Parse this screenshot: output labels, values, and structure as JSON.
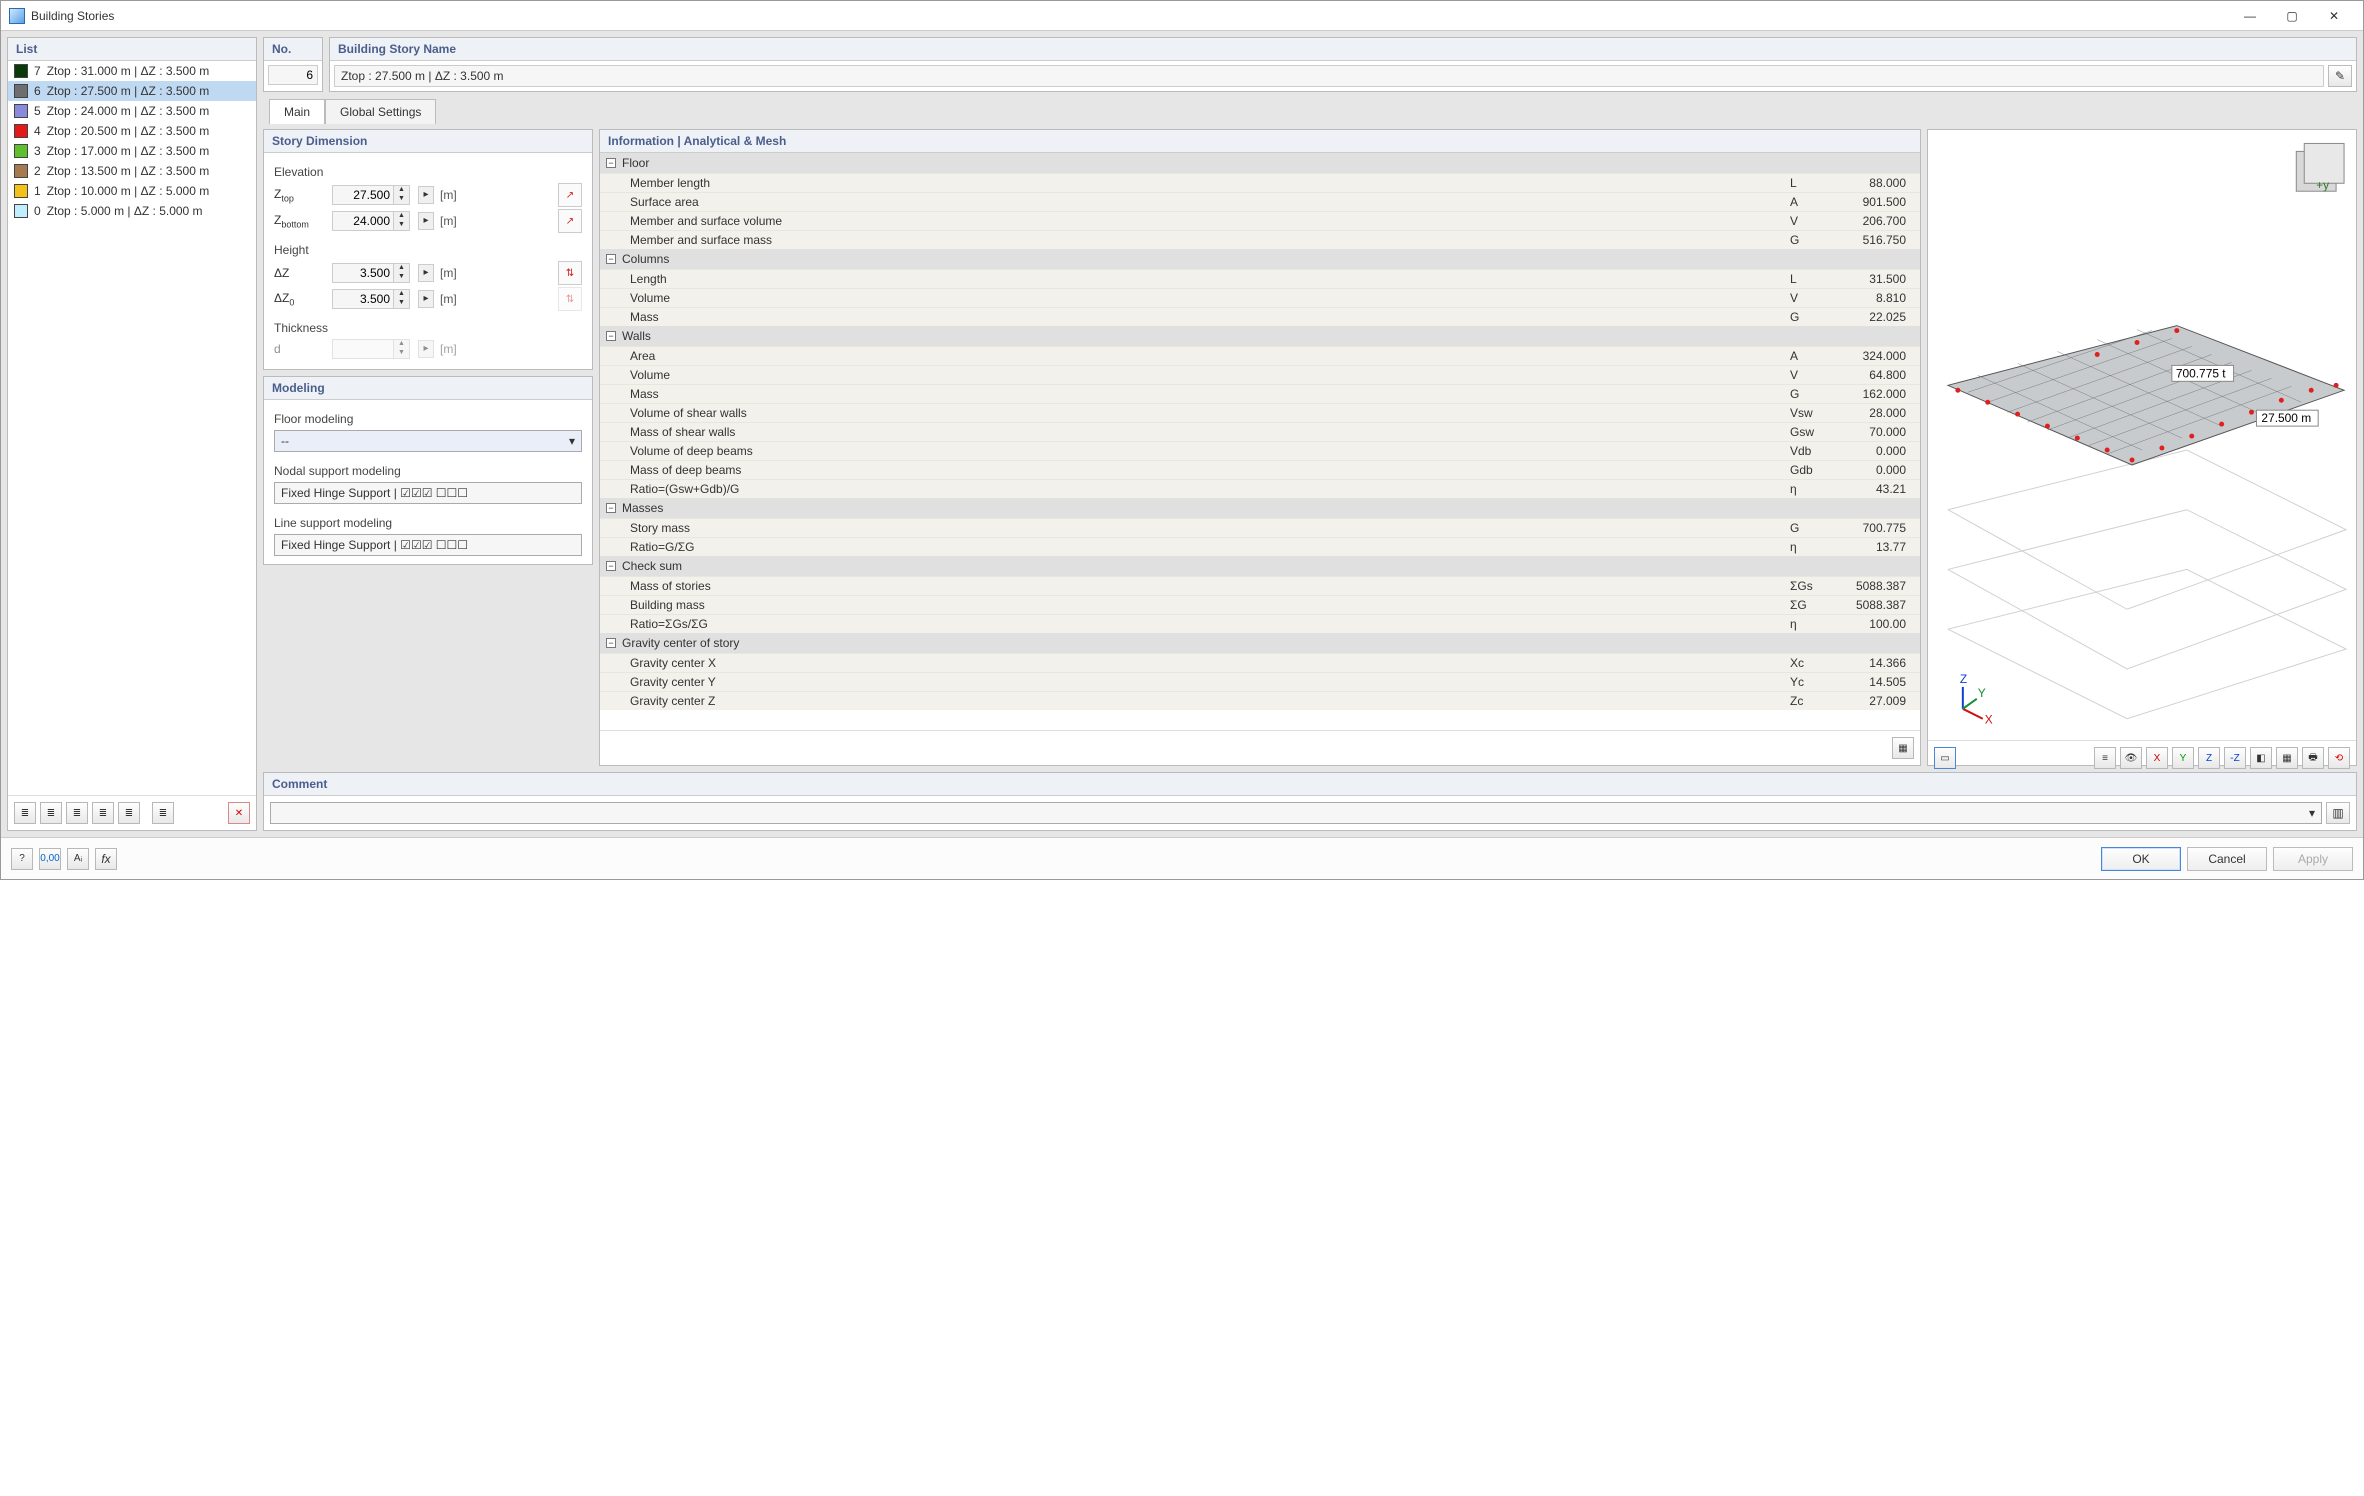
{
  "window_title": "Building Stories",
  "list_header": "List",
  "stories": [
    {
      "num": "7",
      "label": "Ztop : 31.000 m | ΔZ : 3.500 m",
      "color": "#0a3a0a"
    },
    {
      "num": "6",
      "label": "Ztop : 27.500 m | ΔZ : 3.500 m",
      "color": "#6e6e6e",
      "selected": true
    },
    {
      "num": "5",
      "label": "Ztop : 24.000 m | ΔZ : 3.500 m",
      "color": "#8a8adc"
    },
    {
      "num": "4",
      "label": "Ztop : 20.500 m | ΔZ : 3.500 m",
      "color": "#e21a1a"
    },
    {
      "num": "3",
      "label": "Ztop : 17.000 m | ΔZ : 3.500 m",
      "color": "#5fbf2e"
    },
    {
      "num": "2",
      "label": "Ztop : 13.500 m | ΔZ : 3.500 m",
      "color": "#a57a4f"
    },
    {
      "num": "1",
      "label": "Ztop : 10.000 m | ΔZ : 5.000 m",
      "color": "#f2c21a"
    },
    {
      "num": "0",
      "label": "Ztop : 5.000 m | ΔZ : 5.000 m",
      "color": "#bfefff"
    }
  ],
  "no_header": "No.",
  "no_value": "6",
  "name_header": "Building Story Name",
  "name_value": "Ztop : 27.500 m | ΔZ : 3.500 m",
  "tabs": {
    "main": "Main",
    "global": "Global Settings"
  },
  "dim_header": "Story Dimension",
  "labels": {
    "elevation": "Elevation",
    "ztop": "Ztop",
    "zbot": "Zbottom",
    "height": "Height",
    "dz": "ΔZ",
    "dz0": "ΔZ0",
    "thickness": "Thickness",
    "d": "d",
    "m": "[m]"
  },
  "vals": {
    "ztop": "27.500",
    "zbot": "24.000",
    "dz": "3.500",
    "dz0": "3.500",
    "d": ""
  },
  "mod_header": "Modeling",
  "mod": {
    "floor": "Floor modeling",
    "floor_val": "--",
    "nodal": "Nodal support modeling",
    "nodal_val": "Fixed Hinge Support | ☑☑☑ ☐☐☐",
    "line": "Line support modeling",
    "line_val": "Fixed Hinge Support | ☑☑☑ ☐☐☐"
  },
  "info_header": "Information | Analytical & Mesh",
  "groups": [
    {
      "name": "Floor",
      "rows": [
        {
          "n": "Member length",
          "s": "L",
          "v": "88.000"
        },
        {
          "n": "Surface area",
          "s": "A",
          "v": "901.500"
        },
        {
          "n": "Member and surface volume",
          "s": "V",
          "v": "206.700"
        },
        {
          "n": "Member and surface mass",
          "s": "G",
          "v": "516.750"
        }
      ]
    },
    {
      "name": "Columns",
      "rows": [
        {
          "n": "Length",
          "s": "L",
          "v": "31.500"
        },
        {
          "n": "Volume",
          "s": "V",
          "v": "8.810"
        },
        {
          "n": "Mass",
          "s": "G",
          "v": "22.025"
        }
      ]
    },
    {
      "name": "Walls",
      "rows": [
        {
          "n": "Area",
          "s": "A",
          "v": "324.000"
        },
        {
          "n": "Volume",
          "s": "V",
          "v": "64.800"
        },
        {
          "n": "Mass",
          "s": "G",
          "v": "162.000"
        },
        {
          "n": "Volume of shear walls",
          "s": "Vsw",
          "v": "28.000"
        },
        {
          "n": "Mass of shear walls",
          "s": "Gsw",
          "v": "70.000"
        },
        {
          "n": "Volume of deep beams",
          "s": "Vdb",
          "v": "0.000"
        },
        {
          "n": "Mass of deep beams",
          "s": "Gdb",
          "v": "0.000"
        },
        {
          "n": "Ratio=(Gsw+Gdb)/G",
          "s": "η",
          "v": "43.21"
        }
      ]
    },
    {
      "name": "Masses",
      "rows": [
        {
          "n": "Story mass",
          "s": "G",
          "v": "700.775"
        },
        {
          "n": "Ratio=G/ΣG",
          "s": "η",
          "v": "13.77"
        }
      ]
    },
    {
      "name": "Check sum",
      "rows": [
        {
          "n": "Mass of stories",
          "s": "ΣGs",
          "v": "5088.387"
        },
        {
          "n": "Building mass",
          "s": "ΣG",
          "v": "5088.387"
        },
        {
          "n": "Ratio=ΣGs/ΣG",
          "s": "η",
          "v": "100.00"
        }
      ]
    },
    {
      "name": "Gravity center of story",
      "rows": [
        {
          "n": "Gravity center X",
          "s": "Xc",
          "v": "14.366"
        },
        {
          "n": "Gravity center Y",
          "s": "Yc",
          "v": "14.505"
        },
        {
          "n": "Gravity center Z",
          "s": "Zc",
          "v": "27.009"
        }
      ]
    }
  ],
  "comment_header": "Comment",
  "viewer": {
    "mass_label": "700.775 t",
    "z_label": "27.500 m"
  },
  "buttons": {
    "ok": "OK",
    "cancel": "Cancel",
    "apply": "Apply"
  }
}
